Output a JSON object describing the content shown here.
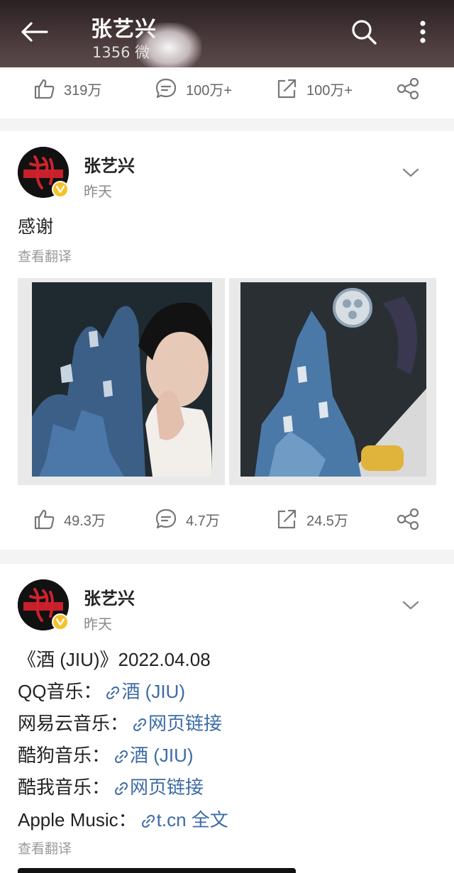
{
  "header": {
    "title": "张艺兴",
    "subtitle": "1356 微"
  },
  "post0": {
    "actions": {
      "like": "319万",
      "comment": "100万+",
      "repost": "100万+"
    }
  },
  "post1": {
    "author": "张艺兴",
    "time": "昨天",
    "text": "感谢",
    "translate": "查看翻译",
    "actions": {
      "like": "49.3万",
      "comment": "4.7万",
      "repost": "24.5万"
    }
  },
  "post2": {
    "author": "张艺兴",
    "time": "昨天",
    "title_line": "《酒 (JIU)》2022.04.08",
    "lines": [
      {
        "label": "QQ音乐：",
        "link": "酒 (JIU)"
      },
      {
        "label": "网易云音乐：",
        "link": "网页链接"
      },
      {
        "label": "酷狗音乐：",
        "link": "酒 (JIU)"
      },
      {
        "label": "酷我音乐：",
        "link": "网页链接"
      },
      {
        "label": "Apple Music：",
        "link": "t.cn",
        "more": "全文"
      }
    ],
    "translate": "查看翻译"
  },
  "colors": {
    "link": "#3d6ba5",
    "verified_badge": "#f6c12a",
    "header_bg": "#3a2e30"
  }
}
